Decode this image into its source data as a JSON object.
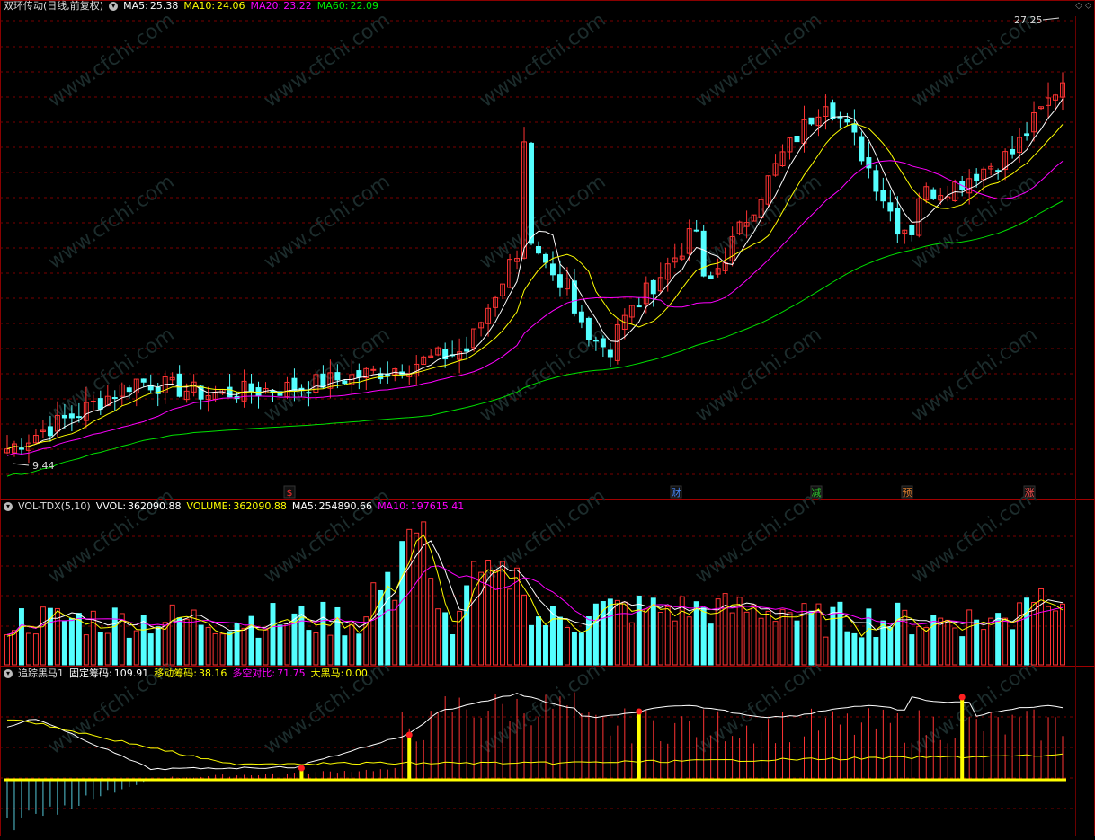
{
  "panels": {
    "price": {
      "stock": "双环传动",
      "period": "(日线,前复权)",
      "ma5": {
        "label": "MA5:",
        "value": "25.38",
        "color": "#ffffff"
      },
      "ma10": {
        "label": "MA10:",
        "value": "24.06",
        "color": "#ffff00"
      },
      "ma20": {
        "label": "MA20:",
        "value": "23.22",
        "color": "#ff00ff"
      },
      "ma60": {
        "label": "MA60:",
        "value": "22.09",
        "color": "#00e000"
      },
      "high_label": "27.25",
      "low_label": "9.44",
      "event_markers": [
        {
          "text": "$",
          "color": "#ff3030"
        },
        {
          "text": "财",
          "color": "#4a8cff"
        },
        {
          "text": "减",
          "color": "#2ec02e"
        },
        {
          "text": "预",
          "color": "#e08030"
        },
        {
          "text": "涨",
          "color": "#ff5050"
        }
      ]
    },
    "volume": {
      "name": "VOL-TDX(5,10)",
      "vvol": {
        "label": "VVOL:",
        "value": "362090.88",
        "color": "#ffffff"
      },
      "volume": {
        "label": "VOLUME:",
        "value": "362090.88",
        "color": "#ffff00"
      },
      "ma5": {
        "label": "MA5:",
        "value": "254890.66",
        "color": "#ffffff"
      },
      "ma10": {
        "label": "MA10:",
        "value": "197615.41",
        "color": "#ff00ff"
      }
    },
    "indicator": {
      "name": "追踪黑马1",
      "fixed": {
        "label": "固定筹码:",
        "value": "109.91",
        "color": "#ffffff"
      },
      "moving": {
        "label": "移动筹码:",
        "value": "38.16",
        "color": "#ffff00"
      },
      "ratio": {
        "label": "多空对比:",
        "value": "71.75",
        "color": "#ff00ff"
      },
      "horse": {
        "label": "大黑马:",
        "value": "0.00",
        "color": "#ffff00"
      }
    }
  },
  "watermark": "www.cfchi.com",
  "colors": {
    "up": "#ff3333",
    "down": "#54ffff",
    "grid": "#7a0000",
    "bg": "#000000"
  },
  "chart_data": [
    {
      "type": "candlestick",
      "title": "双环传动(日线,前复权)",
      "ylim": [
        8.0,
        28.6
      ],
      "y_high_marked": 27.25,
      "y_low_marked": 9.44,
      "n_bars": 148,
      "series": [
        {
          "name": "MA5",
          "last": 25.38
        },
        {
          "name": "MA10",
          "last": 24.06
        },
        {
          "name": "MA20",
          "last": 23.22
        },
        {
          "name": "MA60",
          "last": 22.09
        }
      ]
    },
    {
      "type": "bar",
      "title": "VOL-TDX(5,10)",
      "last_volume": 362090.88,
      "series": [
        {
          "name": "MA5",
          "last": 254890.66
        },
        {
          "name": "MA10",
          "last": 197615.41
        }
      ]
    },
    {
      "type": "line",
      "title": "追踪黑马1",
      "series": [
        {
          "name": "固定筹码",
          "last": 109.91
        },
        {
          "name": "移动筹码",
          "last": 38.16
        },
        {
          "name": "多空对比",
          "last": 71.75
        },
        {
          "name": "大黑马",
          "last": 0.0
        }
      ]
    }
  ]
}
